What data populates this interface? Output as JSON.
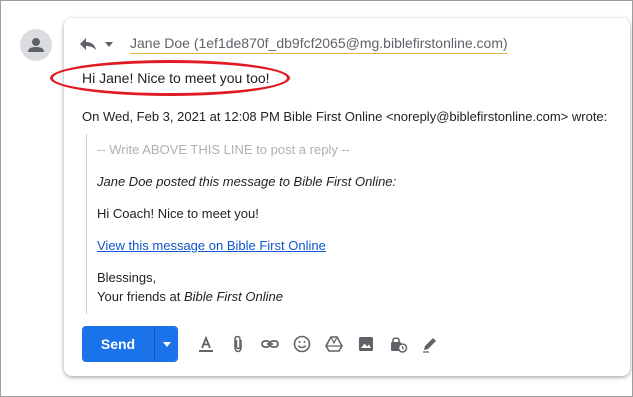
{
  "thread": {
    "recipient": "Jane Doe (1ef1de870f_db9fcf2065@mg.biblefirstonline.com)",
    "reply_text": "Hi Jane! Nice to meet you too!",
    "quote_header": "On Wed, Feb 3, 2021 at 12:08 PM Bible First Online <noreply@biblefirstonline.com> wrote:"
  },
  "quoted": {
    "marker": "-- Write ABOVE THIS LINE to post a reply --",
    "posted_by": "Jane Doe posted this message to Bible First Online:",
    "message": "Hi Coach! Nice to meet you!",
    "link_text": "View this message on Bible First Online",
    "closing": "Blessings,",
    "signoff_prefix": "Your friends at ",
    "signoff_name": "Bible First Online"
  },
  "toolbar": {
    "send_label": "Send",
    "icons": [
      "text-format-icon",
      "attach-icon",
      "link-icon",
      "emoji-icon",
      "drive-icon",
      "photo-icon",
      "confidential-icon",
      "signature-icon"
    ]
  },
  "colors": {
    "send": "#1a73e8",
    "highlight_circle": "#e01b24",
    "link": "#1155cc"
  }
}
